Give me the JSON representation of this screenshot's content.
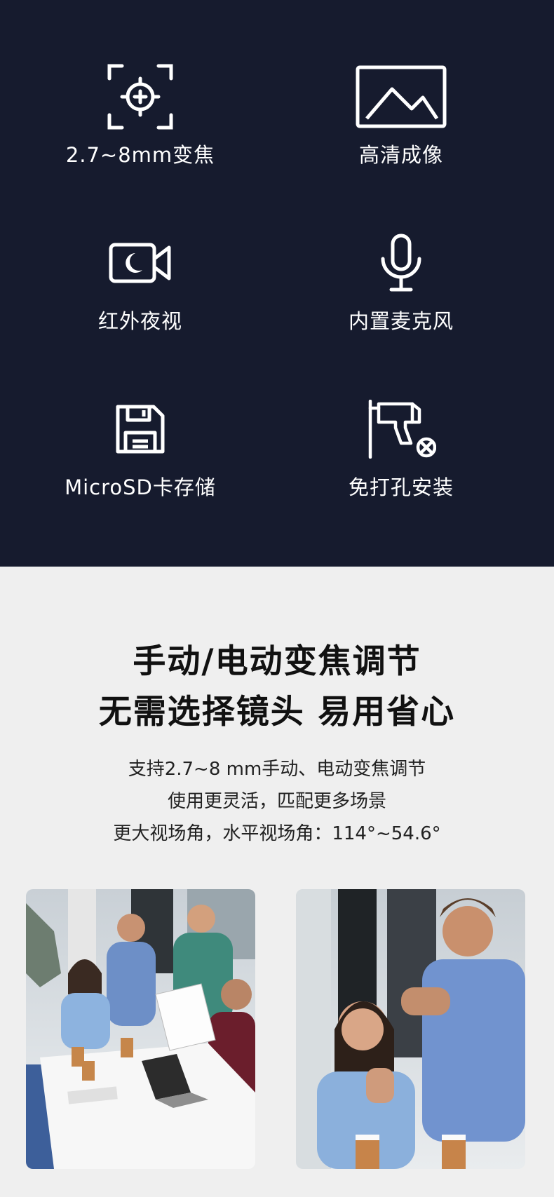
{
  "features": [
    {
      "icon": "zoom-focus-icon",
      "label": "2.7~8mm变焦"
    },
    {
      "icon": "hd-image-icon",
      "label": "高清成像"
    },
    {
      "icon": "night-vision-camera-icon",
      "label": "红外夜视"
    },
    {
      "icon": "microphone-icon",
      "label": "内置麦克风"
    },
    {
      "icon": "floppy-disk-icon",
      "label": "MicroSD卡存储"
    },
    {
      "icon": "no-drill-icon",
      "label": "免打孔安装"
    }
  ],
  "headline": {
    "line1": "手动/电动变焦调节",
    "line2": "无需选择镜头  易用省心"
  },
  "description": {
    "line1": "支持2.7~8 mm手动、电动变焦调节",
    "line2": "使用更灵活，匹配更多场景",
    "line3": "更大视场角，水平视场角：114°~54.6°"
  },
  "photos": [
    {
      "name": "office-meeting-photo"
    },
    {
      "name": "applause-photo"
    }
  ],
  "colors": {
    "panel_bg": "#161b2e",
    "lower_bg": "#efefef",
    "text_dark": "#111111"
  }
}
